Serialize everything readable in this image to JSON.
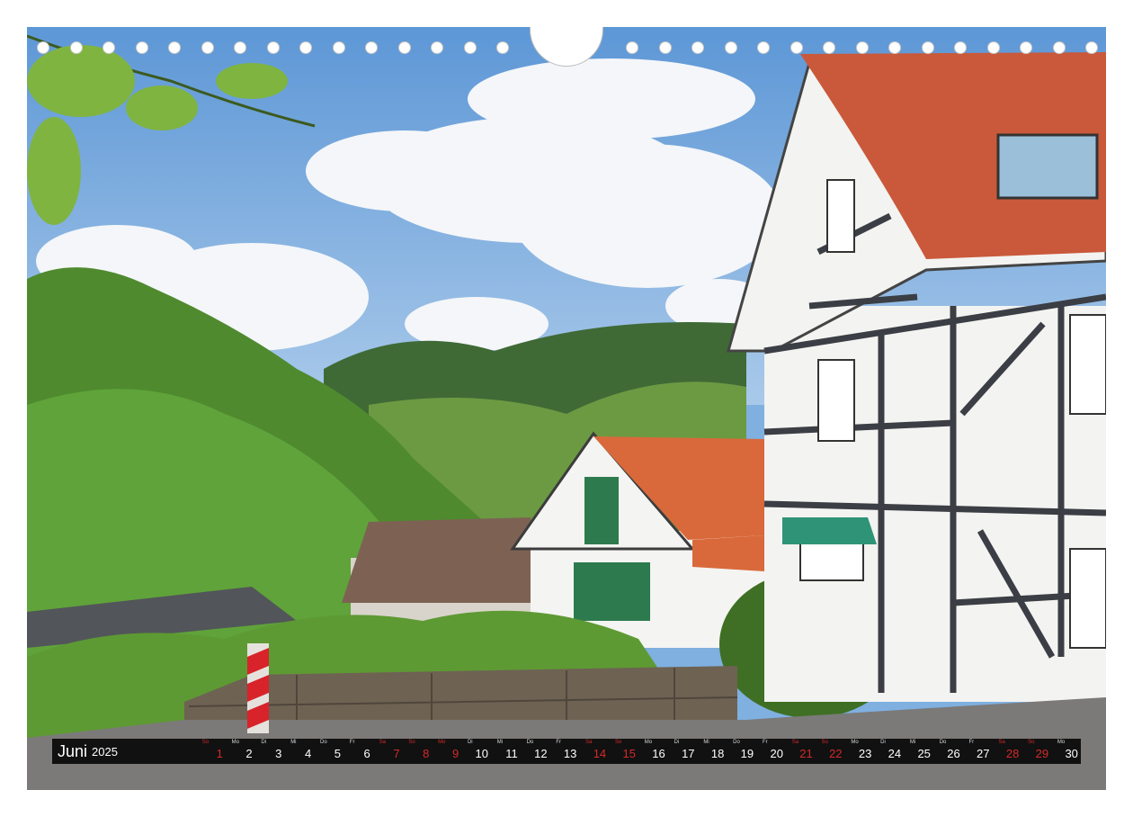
{
  "calendar": {
    "month_name": "Juni",
    "year": "2025",
    "days": [
      {
        "dow": "So",
        "num": "1",
        "weekend": true
      },
      {
        "dow": "Mo",
        "num": "2",
        "weekend": false
      },
      {
        "dow": "Di",
        "num": "3",
        "weekend": false
      },
      {
        "dow": "Mi",
        "num": "4",
        "weekend": false
      },
      {
        "dow": "Do",
        "num": "5",
        "weekend": false
      },
      {
        "dow": "Fr",
        "num": "6",
        "weekend": false
      },
      {
        "dow": "Sa",
        "num": "7",
        "weekend": true
      },
      {
        "dow": "So",
        "num": "8",
        "weekend": true
      },
      {
        "dow": "Mo",
        "num": "9",
        "weekend": true
      },
      {
        "dow": "Di",
        "num": "10",
        "weekend": false
      },
      {
        "dow": "Mi",
        "num": "11",
        "weekend": false
      },
      {
        "dow": "Do",
        "num": "12",
        "weekend": false
      },
      {
        "dow": "Fr",
        "num": "13",
        "weekend": false
      },
      {
        "dow": "Sa",
        "num": "14",
        "weekend": true
      },
      {
        "dow": "So",
        "num": "15",
        "weekend": true
      },
      {
        "dow": "Mo",
        "num": "16",
        "weekend": false
      },
      {
        "dow": "Di",
        "num": "17",
        "weekend": false
      },
      {
        "dow": "Mi",
        "num": "18",
        "weekend": false
      },
      {
        "dow": "Do",
        "num": "19",
        "weekend": false
      },
      {
        "dow": "Fr",
        "num": "20",
        "weekend": false
      },
      {
        "dow": "Sa",
        "num": "21",
        "weekend": true
      },
      {
        "dow": "So",
        "num": "22",
        "weekend": true
      },
      {
        "dow": "Mo",
        "num": "23",
        "weekend": false
      },
      {
        "dow": "Di",
        "num": "24",
        "weekend": false
      },
      {
        "dow": "Mi",
        "num": "25",
        "weekend": false
      },
      {
        "dow": "Do",
        "num": "26",
        "weekend": false
      },
      {
        "dow": "Fr",
        "num": "27",
        "weekend": false
      },
      {
        "dow": "Sa",
        "num": "28",
        "weekend": true
      },
      {
        "dow": "So",
        "num": "29",
        "weekend": true
      },
      {
        "dow": "Mo",
        "num": "30",
        "weekend": false
      }
    ]
  },
  "colors": {
    "strip_background": "#111111",
    "weekday_text": "#ffffff",
    "weekend_text": "#d42a2a"
  }
}
